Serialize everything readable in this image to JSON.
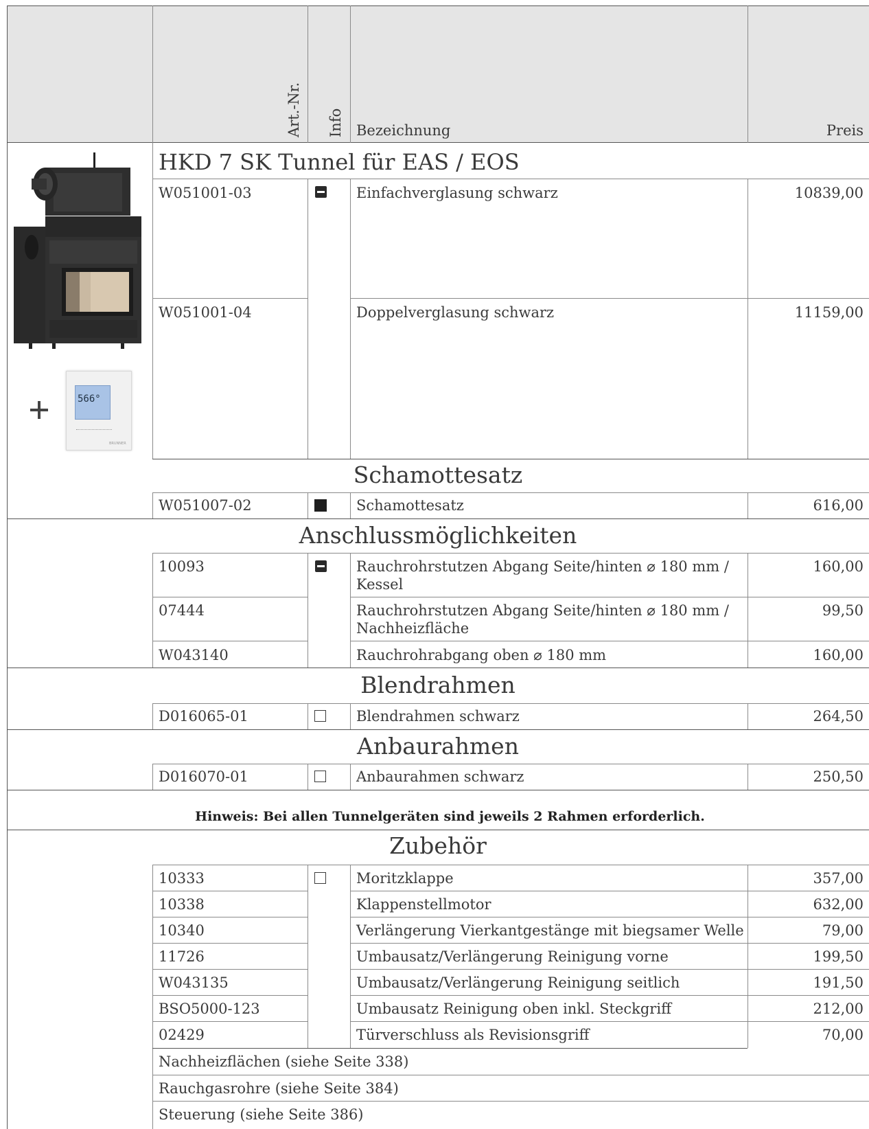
{
  "header": {
    "art_nr": "Art.-Nr.",
    "info": "Info",
    "bezeichnung": "Bezeichnung",
    "preis": "Preis"
  },
  "product": {
    "title": "HKD 7 SK Tunnel für EAS / EOS",
    "rows": [
      {
        "art": "W051001-03",
        "desc": "Einfachverglasung schwarz",
        "price": "10839,00"
      },
      {
        "art": "W051001-04",
        "desc": "Doppelverglasung schwarz",
        "price": "11159,00"
      }
    ],
    "controller_display": "566°"
  },
  "schamottesatz": {
    "title": "Schamottesatz",
    "rows": [
      {
        "art": "W051007-02",
        "desc": "Schamottesatz",
        "price": "616,00"
      }
    ]
  },
  "anschluss": {
    "title": "Anschlussmöglichkeiten",
    "rows": [
      {
        "art": "10093",
        "desc1": "Rauchrohrstutzen Abgang Seite/hinten ⌀ 180 mm /",
        "desc2": "Kessel",
        "price": "160,00"
      },
      {
        "art": "07444",
        "desc1": "Rauchrohrstutzen Abgang Seite/hinten ⌀ 180 mm /",
        "desc2": "Nachheizfläche",
        "price": "99,50"
      },
      {
        "art": "W043140",
        "desc1": "Rauchrohrabgang oben ⌀ 180 mm",
        "price": "160,00"
      }
    ]
  },
  "blendrahmen": {
    "title": "Blendrahmen",
    "rows": [
      {
        "art": "D016065-01",
        "desc": "Blendrahmen schwarz",
        "price": "264,50"
      }
    ]
  },
  "anbaurahmen": {
    "title": "Anbaurahmen",
    "rows": [
      {
        "art": "D016070-01",
        "desc": "Anbaurahmen schwarz",
        "price": "250,50"
      }
    ]
  },
  "hint": "Hinweis: Bei allen Tunnelgeräten sind jeweils 2 Rahmen erforderlich.",
  "zubehoer": {
    "title": "Zubehör",
    "rows": [
      {
        "art": "10333",
        "desc": "Moritzklappe",
        "price": "357,00"
      },
      {
        "art": "10338",
        "desc": "Klappenstellmotor",
        "price": "632,00"
      },
      {
        "art": "10340",
        "desc": "Verlängerung Vierkantgestänge mit biegsamer Welle",
        "price": "79,00"
      },
      {
        "art": "11726",
        "desc": "Umbausatz/Verlängerung Reinigung vorne",
        "price": "199,50"
      },
      {
        "art": "W043135",
        "desc": "Umbausatz/Verlängerung Reinigung seitlich",
        "price": "191,50"
      },
      {
        "art": "BSO5000-123",
        "desc": "Umbausatz Reinigung oben inkl. Steckgriff",
        "price": "212,00"
      },
      {
        "art": "02429",
        "desc": "Türverschluss als Revisionsgriff",
        "price": "70,00"
      }
    ],
    "refs": [
      "Nachheizflächen (siehe Seite 338)",
      "Rauchgasrohre (siehe Seite 384)",
      "Steuerung (siehe Seite 386)"
    ]
  }
}
